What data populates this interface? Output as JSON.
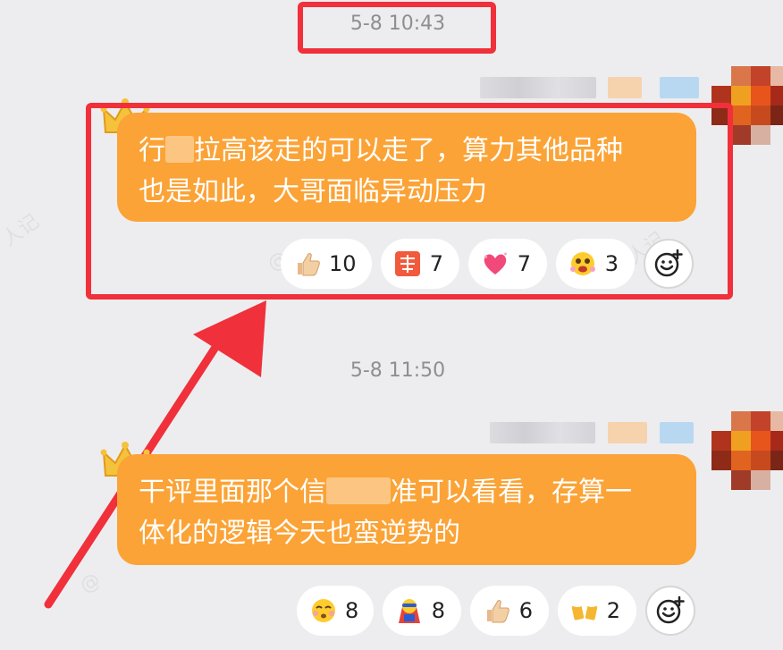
{
  "messages": [
    {
      "timestamp": "5-8 10:43",
      "text_line1_a": "行",
      "text_line1_b": "拉高该走的可以走了，算力其他品种",
      "text_line2": "也是如此，大哥面临异动压力",
      "reactions": [
        {
          "icon": "thumbs-up-icon",
          "count": "10"
        },
        {
          "icon": "zan-icon",
          "count": "7"
        },
        {
          "icon": "heart-icon",
          "count": "7"
        },
        {
          "icon": "laughing-face-icon",
          "count": "3"
        }
      ]
    },
    {
      "timestamp": "5-8 11:50",
      "text_line1_a": "干评里面那个信",
      "text_line1_b": "准可以看看，存算一",
      "text_line2": "体化的逻辑今天也蛮逆势的",
      "reactions": [
        {
          "icon": "blushing-face-icon",
          "count": "8"
        },
        {
          "icon": "superhero-icon",
          "count": "8"
        },
        {
          "icon": "thumbs-up-icon",
          "count": "6"
        },
        {
          "icon": "beer-mugs-icon",
          "count": "2"
        }
      ]
    }
  ],
  "colors": {
    "background": "#ededf0",
    "bubble": "#fba336",
    "highlight": "#f0303a",
    "timestamp": "#8e8e93"
  }
}
